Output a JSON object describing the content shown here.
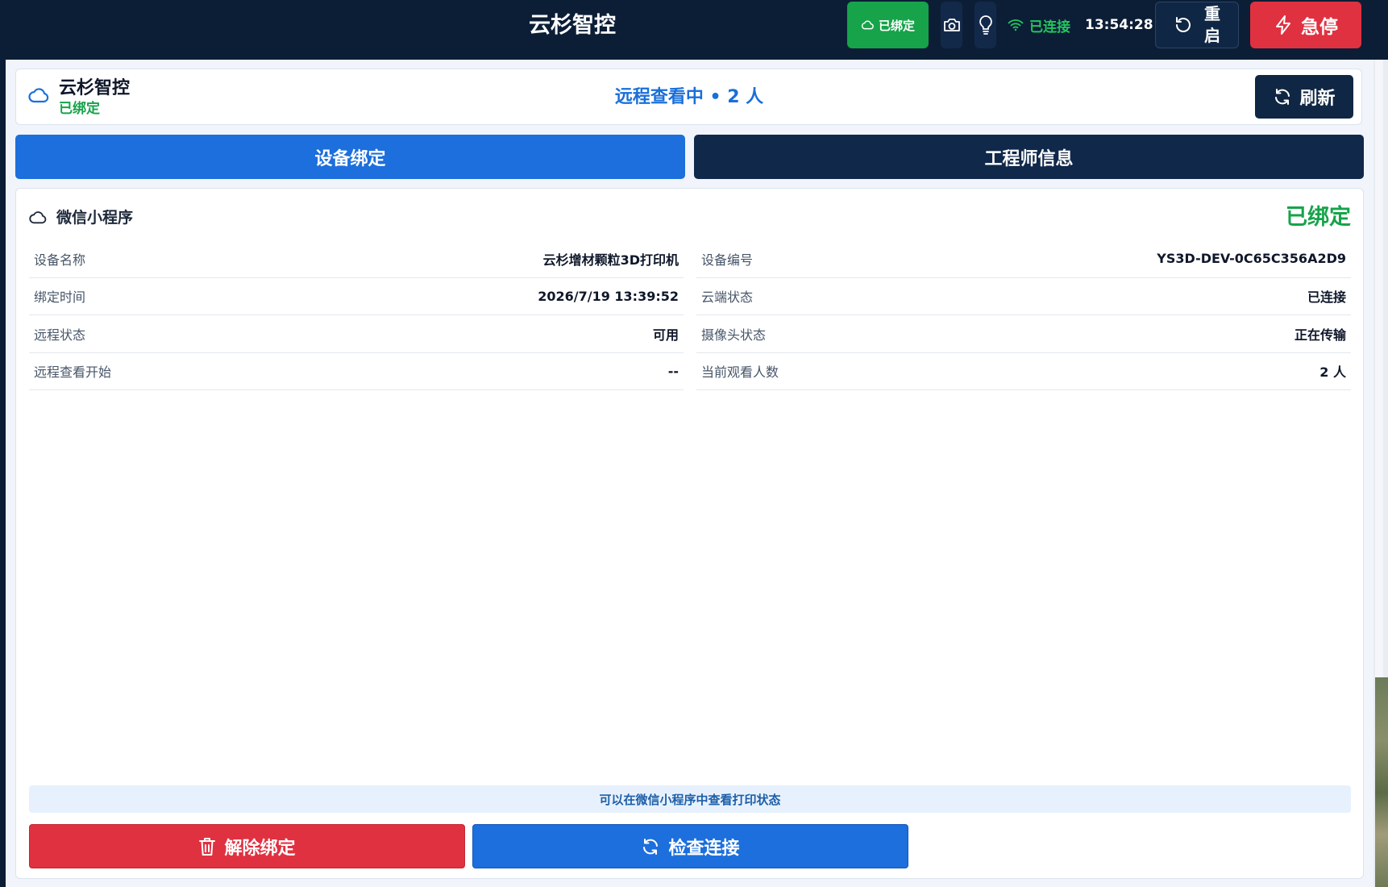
{
  "topbar": {
    "title": "云杉智控",
    "bound_label": "已绑定",
    "wifi_label": "已连接",
    "time": "13:54:28",
    "restart_line1": "重",
    "restart_line2": "启",
    "estop_label": "急停"
  },
  "header": {
    "device_name": "云杉智控",
    "bind_status": "已绑定",
    "remote_status": "远程查看中 • 2 人",
    "refresh_label": "刷新"
  },
  "tabs": [
    {
      "label": "设备绑定",
      "active": true
    },
    {
      "label": "工程师信息",
      "active": false
    }
  ],
  "card": {
    "title": "微信小程序",
    "status": "已绑定",
    "left_rows": [
      {
        "label": "设备名称",
        "value": "云杉增材颗粒3D打印机"
      },
      {
        "label": "绑定时间",
        "value": "2026/7/19 13:39:52"
      },
      {
        "label": "远程状态",
        "value": "可用"
      },
      {
        "label": "远程查看开始",
        "value": "--"
      }
    ],
    "right_rows": [
      {
        "label": "设备编号",
        "value": "YS3D-DEV-0C65C356A2D9"
      },
      {
        "label": "云端状态",
        "value": "已连接"
      },
      {
        "label": "摄像头状态",
        "value": "正在传输"
      },
      {
        "label": "当前观看人数",
        "value": "2 人"
      }
    ],
    "hint": "可以在微信小程序中查看打印状态",
    "unbind_label": "解除绑定",
    "check_label": "检查连接"
  },
  "colors": {
    "topbar_bg": "#0c1e36",
    "success": "#16a34a",
    "primary": "#1c6fdc",
    "danger": "#e03140",
    "navy": "#10284a"
  }
}
